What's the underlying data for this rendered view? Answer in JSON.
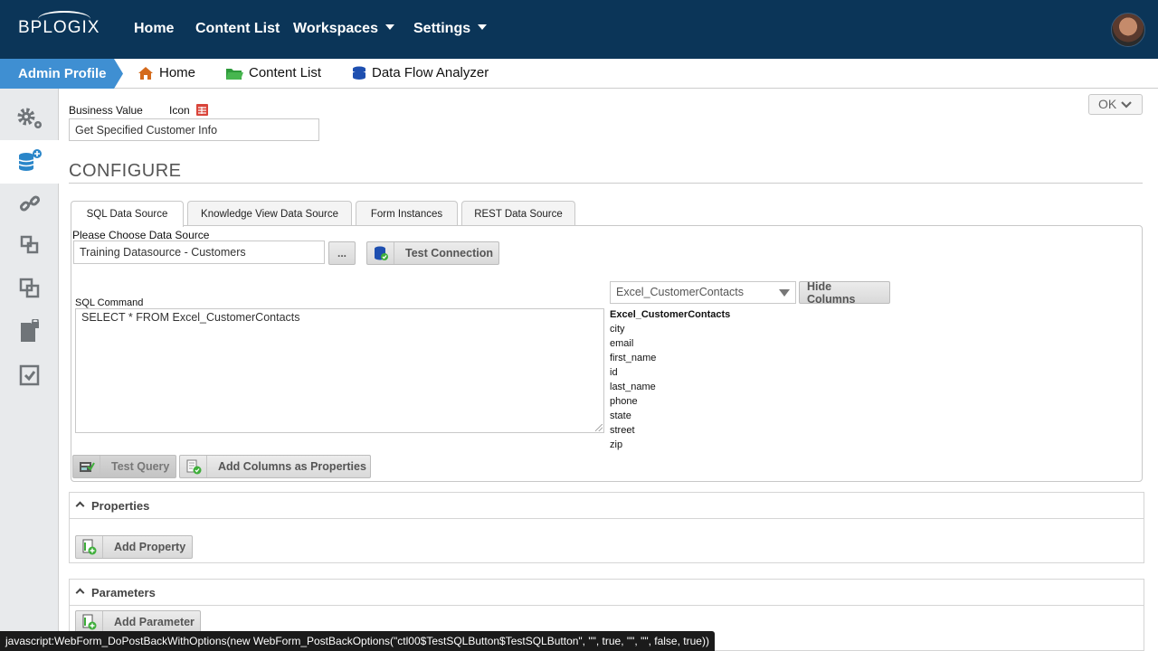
{
  "brand": {
    "logo_text": "BPLOGIX"
  },
  "topnav": {
    "home": "Home",
    "content_list": "Content List",
    "workspaces": "Workspaces",
    "settings": "Settings"
  },
  "subnav": {
    "admin_profile": "Admin Profile",
    "home": "Home",
    "content_list": "Content List",
    "data_flow_analyzer": "Data Flow Analyzer"
  },
  "rail": {
    "items": [
      "gear-icon",
      "database-add-icon",
      "link-icon",
      "stack-icon",
      "copy-icon",
      "locked-file-icon",
      "checklist-icon"
    ],
    "active_index": 1
  },
  "header": {
    "business_value_label": "Business Value",
    "icon_label": "Icon",
    "business_value": "Get Specified Customer Info",
    "ok_label": "OK"
  },
  "section": {
    "title": "CONFIGURE"
  },
  "tabs": [
    {
      "label": "SQL Data Source",
      "active": true
    },
    {
      "label": "Knowledge View Data Source",
      "active": false
    },
    {
      "label": "Form Instances",
      "active": false
    },
    {
      "label": "REST Data Source",
      "active": false
    }
  ],
  "sql": {
    "choose_label": "Please Choose Data Source",
    "data_source": "Training Datasource - Customers",
    "browse_label": "...",
    "test_connection_label": "Test Connection",
    "command_label": "SQL Command",
    "command": "SELECT * FROM Excel_CustomerContacts",
    "table_select": "Excel_CustomerContacts",
    "hide_columns_label": "Hide Columns",
    "table_name": "Excel_CustomerContacts",
    "columns": [
      "city",
      "email",
      "first_name",
      "id",
      "last_name",
      "phone",
      "state",
      "street",
      "zip"
    ],
    "test_query_label": "Test Query",
    "add_columns_label": "Add Columns as Properties"
  },
  "properties": {
    "title": "Properties",
    "add_label": "Add Property"
  },
  "parameters": {
    "title": "Parameters",
    "add_label": "Add Parameter"
  },
  "status": {
    "text": "javascript:WebForm_DoPostBackWithOptions(new WebForm_PostBackOptions(\"ctl00$TestSQLButton$TestSQLButton\", \"\", true, \"\", \"\", false, true))"
  },
  "colors": {
    "nav_bg": "#0b3558",
    "accent": "#3f8fd2",
    "rail_bg": "#e8eaec"
  }
}
